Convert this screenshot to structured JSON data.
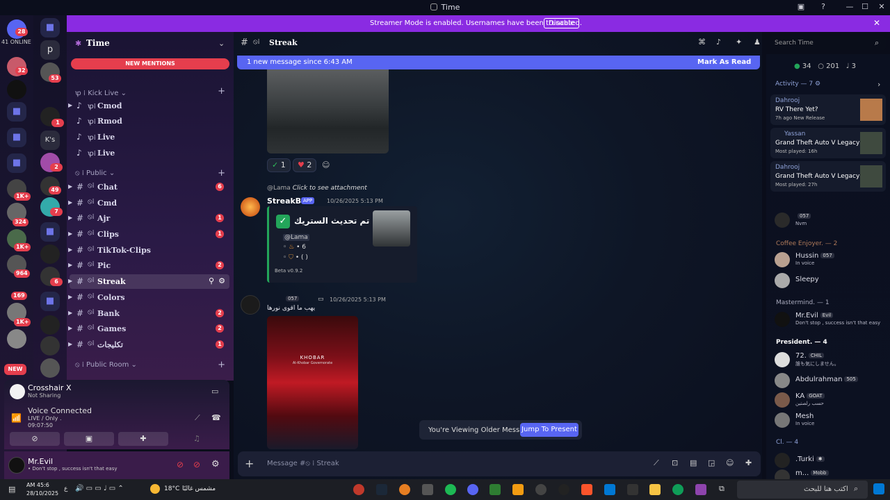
{
  "window": {
    "title": "Time"
  },
  "rail": {
    "online_count": "41 ONLINE",
    "badges": [
      "28",
      "32",
      "53",
      "1",
      "2",
      "49",
      "7",
      "1K+",
      "324",
      "1K+",
      "964",
      "6",
      "169",
      "1K+",
      "NEW"
    ],
    "letters": [
      "p",
      "K's"
    ]
  },
  "banner": {
    "text": "Streamer Mode is enabled. Usernames have been truncated.",
    "disable_label": "Disable"
  },
  "server": {
    "name": "Time",
    "new_mentions": "NEW MENTIONS",
    "categories": [
      {
        "name": "ꝕ ⁞ Kick Live ⌄"
      },
      {
        "name": "⦸ ⁞ Public ⌄"
      },
      {
        "name": "⦸ ⁞ Public Room ⌄"
      }
    ],
    "voice_channels": [
      {
        "label": "Cmod"
      },
      {
        "label": "Rmod"
      },
      {
        "label": "Live"
      },
      {
        "label": "Live"
      }
    ],
    "text_channels": [
      {
        "label": "Chat",
        "count": "6"
      },
      {
        "label": "Cmd",
        "count": ""
      },
      {
        "label": "Ajr",
        "count": "1"
      },
      {
        "label": "Clips",
        "count": "1"
      },
      {
        "label": "TikTok-Clips",
        "count": ""
      },
      {
        "label": "Pic",
        "count": "2"
      },
      {
        "label": "Streak",
        "count": ""
      },
      {
        "label": "Colors",
        "count": ""
      },
      {
        "label": "Bank",
        "count": "2"
      },
      {
        "label": "Games",
        "count": "2"
      },
      {
        "label": "تكليجات",
        "count": "1"
      }
    ]
  },
  "voice": {
    "app_name": "Crosshair X",
    "app_status": "Not Sharing",
    "connected": "Voice Connected",
    "channel": "LIVE / Only .",
    "timer": "09:07:50"
  },
  "user": {
    "name": "Mr.Evil",
    "status": "• Don't stop , success isn't that easy"
  },
  "chat": {
    "channel_name": "Streak",
    "new_message_bar": "1 new message since 6:43 AM",
    "mark_read": "Mark As Read",
    "reactions": [
      {
        "emoji": "✓",
        "count": "1"
      },
      {
        "emoji": "♥",
        "count": "2"
      }
    ],
    "reply_user": "@Lama",
    "reply_text": "Click to see attachment",
    "bot_name": "StreakBot",
    "bot_tag": "APP",
    "bot_time": "10/26/2025 5:13 PM",
    "embed_title": "تم تحديث الستريك •",
    "embed_mention": "@Lama",
    "embed_line1": "• 6",
    "embed_line2": "• ( )",
    "embed_footer": "Beta v0.9.2",
    "msg2_tag": "057",
    "msg2_time": "10/26/2025 5:13 PM",
    "msg2_text": "يهب ما اقوى نورها",
    "image_caption1": "KHOBAR",
    "image_caption2": "Al-Khobar Governorate",
    "older_notice": "You're Viewing Older Messages",
    "jump_label": "Jump To Present",
    "composer_placeholder": "Message #⦸ ⁞ Streak"
  },
  "members": {
    "search_placeholder": "Search Time",
    "online": "34",
    "total": "201",
    "voice": "3",
    "activity_title": "Activity — 7",
    "activities": [
      {
        "user": "Dahrooj",
        "title": "RV There Yet?",
        "meta": "7h ago   New Release"
      },
      {
        "user": "Yassan",
        "title": "Grand Theft Auto V Legacy",
        "meta": "Most played: 16h"
      },
      {
        "user": "Dahrooj",
        "title": "Grand Theft Auto V Legacy",
        "meta": "Most played: 27h"
      }
    ],
    "groups": [
      {
        "title": "Coffee Enjoyer. — 2",
        "y": 0
      },
      {
        "title": "Mastermind. — 1",
        "y": 0
      },
      {
        "title": "President. — 4",
        "y": 0
      },
      {
        "title": "Cl. — 4",
        "y": 0
      }
    ],
    "list": [
      {
        "name": "",
        "tag": "057",
        "status": "Nvm"
      },
      {
        "name": "Hussin",
        "tag": "057",
        "status": "In voice"
      },
      {
        "name": "Sleepy",
        "tag": "",
        "status": ""
      },
      {
        "name": "Mr.Evil",
        "tag": "Evil",
        "status": "Don't stop , success isn't that easy"
      },
      {
        "name": "72.",
        "tag": "CHIL",
        "status": "誰も気にしません。"
      },
      {
        "name": "Abdulrahman",
        "tag": "505",
        "status": ""
      },
      {
        "name": "KA",
        "tag": "GOAT",
        "status": "حسب رلصتين"
      },
      {
        "name": "Mesh",
        "tag": "",
        "status": "In voice"
      },
      {
        "name": ".Turki",
        "tag": "✱",
        "status": ""
      },
      {
        "name": "m...",
        "tag": "Mobb",
        "status": ""
      }
    ]
  },
  "taskbar": {
    "time": "AM 45:6",
    "date": "28/10/2025",
    "weather": "18°C",
    "weather_desc": "مشمس غالبًا",
    "search": "اكتب هنا للبحث",
    "lang": "ع"
  },
  "colors": {
    "accent": "#5865f2",
    "streamer": "#8a2be2",
    "badge": "#e53e4d",
    "online": "#23a55a"
  }
}
